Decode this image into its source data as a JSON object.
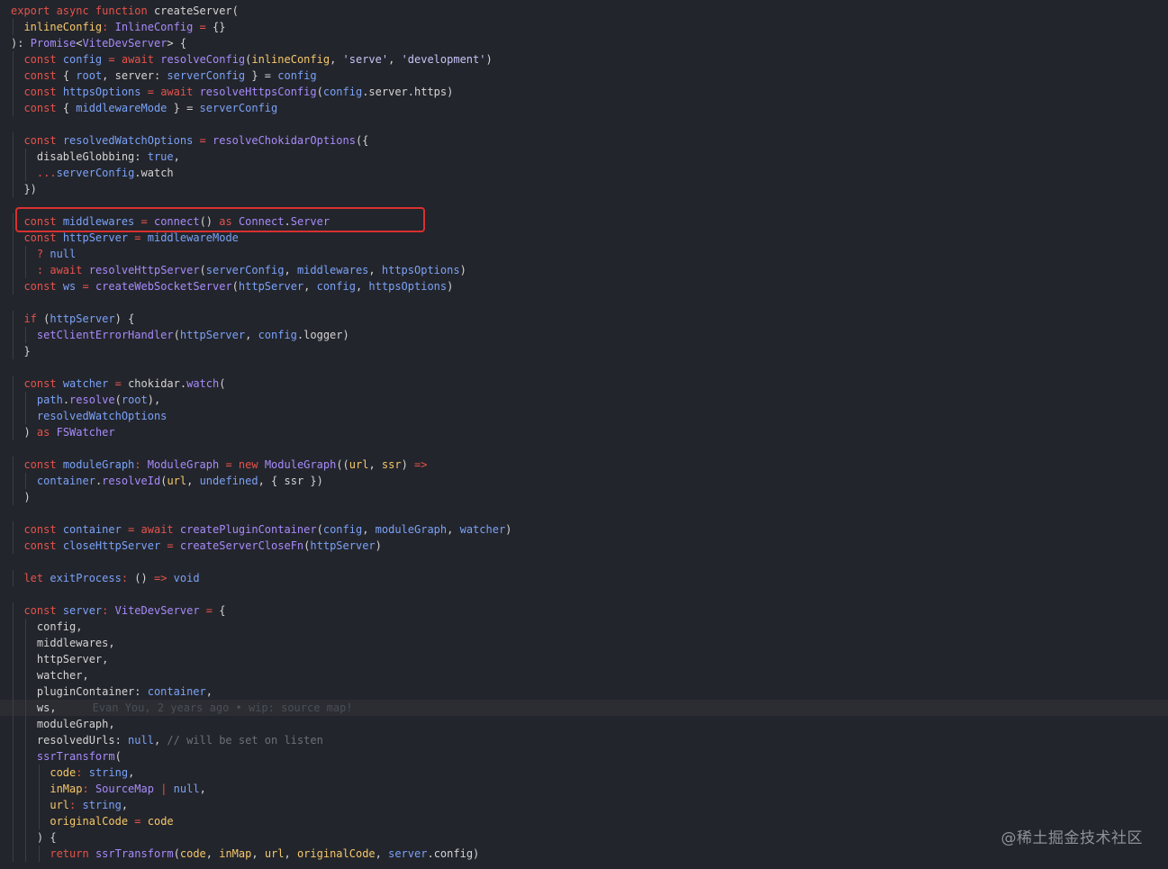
{
  "editor": {
    "current_line_index": 43,
    "indent_char_width": 7.2,
    "colors": {
      "background": "#23252c",
      "keyword": "#e5534b",
      "function": "#a78bfa",
      "identifier": "#7aa2f7",
      "type": "#a78bfa",
      "string": "#c4c4f5",
      "plain": "#d4d4d4",
      "operator": "#e5534b",
      "param": "#f5c86a",
      "comment": "#6b7079",
      "literal": "#7aa2f7",
      "highlight_box": "#d8302f"
    },
    "lines": [
      [
        {
          "t": "export async function ",
          "c": "keyword"
        },
        {
          "t": "createServer",
          "c": "plain"
        },
        {
          "t": "(",
          "c": "plain"
        }
      ],
      [
        {
          "t": "  ",
          "c": "plain"
        },
        {
          "t": "inlineConfig",
          "c": "param"
        },
        {
          "t": ": ",
          "c": "operator"
        },
        {
          "t": "InlineConfig",
          "c": "type"
        },
        {
          "t": " = ",
          "c": "operator"
        },
        {
          "t": "{}",
          "c": "plain"
        }
      ],
      [
        {
          "t": "): ",
          "c": "plain"
        },
        {
          "t": "Promise",
          "c": "type"
        },
        {
          "t": "<",
          "c": "plain"
        },
        {
          "t": "ViteDevServer",
          "c": "type"
        },
        {
          "t": "> {",
          "c": "plain"
        }
      ],
      [
        {
          "t": "  ",
          "c": "plain"
        },
        {
          "t": "const ",
          "c": "keyword"
        },
        {
          "t": "config",
          "c": "identifier"
        },
        {
          "t": " = ",
          "c": "operator"
        },
        {
          "t": "await ",
          "c": "keyword"
        },
        {
          "t": "resolveConfig",
          "c": "function"
        },
        {
          "t": "(",
          "c": "plain"
        },
        {
          "t": "inlineConfig",
          "c": "param"
        },
        {
          "t": ", ",
          "c": "plain"
        },
        {
          "t": "'serve'",
          "c": "string"
        },
        {
          "t": ", ",
          "c": "plain"
        },
        {
          "t": "'development'",
          "c": "string"
        },
        {
          "t": ")",
          "c": "plain"
        }
      ],
      [
        {
          "t": "  ",
          "c": "plain"
        },
        {
          "t": "const ",
          "c": "keyword"
        },
        {
          "t": "{ ",
          "c": "plain"
        },
        {
          "t": "root",
          "c": "identifier"
        },
        {
          "t": ", server: ",
          "c": "plain"
        },
        {
          "t": "serverConfig",
          "c": "identifier"
        },
        {
          "t": " } = ",
          "c": "plain"
        },
        {
          "t": "config",
          "c": "identifier"
        }
      ],
      [
        {
          "t": "  ",
          "c": "plain"
        },
        {
          "t": "const ",
          "c": "keyword"
        },
        {
          "t": "httpsOptions",
          "c": "identifier"
        },
        {
          "t": " = ",
          "c": "operator"
        },
        {
          "t": "await ",
          "c": "keyword"
        },
        {
          "t": "resolveHttpsConfig",
          "c": "function"
        },
        {
          "t": "(",
          "c": "plain"
        },
        {
          "t": "config",
          "c": "identifier"
        },
        {
          "t": ".server.https)",
          "c": "plain"
        }
      ],
      [
        {
          "t": "  ",
          "c": "plain"
        },
        {
          "t": "const ",
          "c": "keyword"
        },
        {
          "t": "{ ",
          "c": "plain"
        },
        {
          "t": "middlewareMode",
          "c": "identifier"
        },
        {
          "t": " } = ",
          "c": "plain"
        },
        {
          "t": "serverConfig",
          "c": "identifier"
        }
      ],
      [
        {
          "t": "",
          "c": "plain"
        }
      ],
      [
        {
          "t": "  ",
          "c": "plain"
        },
        {
          "t": "const ",
          "c": "keyword"
        },
        {
          "t": "resolvedWatchOptions",
          "c": "identifier"
        },
        {
          "t": " = ",
          "c": "operator"
        },
        {
          "t": "resolveChokidarOptions",
          "c": "function"
        },
        {
          "t": "({",
          "c": "plain"
        }
      ],
      [
        {
          "t": "    ",
          "c": "plain"
        },
        {
          "t": "disableGlobbing: ",
          "c": "plain"
        },
        {
          "t": "true",
          "c": "literal"
        },
        {
          "t": ",",
          "c": "plain"
        }
      ],
      [
        {
          "t": "    ",
          "c": "plain"
        },
        {
          "t": "...",
          "c": "operator"
        },
        {
          "t": "serverConfig",
          "c": "identifier"
        },
        {
          "t": ".watch",
          "c": "plain"
        }
      ],
      [
        {
          "t": "  })",
          "c": "plain"
        }
      ],
      [
        {
          "t": "",
          "c": "plain"
        }
      ],
      [
        {
          "t": "  ",
          "c": "plain"
        },
        {
          "t": "const ",
          "c": "keyword"
        },
        {
          "t": "middlewares",
          "c": "identifier"
        },
        {
          "t": " = ",
          "c": "operator"
        },
        {
          "t": "connect",
          "c": "function"
        },
        {
          "t": "() ",
          "c": "plain"
        },
        {
          "t": "as ",
          "c": "keyword"
        },
        {
          "t": "Connect",
          "c": "type"
        },
        {
          "t": ".",
          "c": "plain"
        },
        {
          "t": "Server",
          "c": "type"
        }
      ],
      [
        {
          "t": "  ",
          "c": "plain"
        },
        {
          "t": "const ",
          "c": "keyword"
        },
        {
          "t": "httpServer",
          "c": "identifier"
        },
        {
          "t": " = ",
          "c": "operator"
        },
        {
          "t": "middlewareMode",
          "c": "identifier"
        }
      ],
      [
        {
          "t": "    ",
          "c": "plain"
        },
        {
          "t": "? ",
          "c": "operator"
        },
        {
          "t": "null",
          "c": "literal"
        }
      ],
      [
        {
          "t": "    ",
          "c": "plain"
        },
        {
          "t": ": ",
          "c": "operator"
        },
        {
          "t": "await ",
          "c": "keyword"
        },
        {
          "t": "resolveHttpServer",
          "c": "function"
        },
        {
          "t": "(",
          "c": "plain"
        },
        {
          "t": "serverConfig",
          "c": "identifier"
        },
        {
          "t": ", ",
          "c": "plain"
        },
        {
          "t": "middlewares",
          "c": "identifier"
        },
        {
          "t": ", ",
          "c": "plain"
        },
        {
          "t": "httpsOptions",
          "c": "identifier"
        },
        {
          "t": ")",
          "c": "plain"
        }
      ],
      [
        {
          "t": "  ",
          "c": "plain"
        },
        {
          "t": "const ",
          "c": "keyword"
        },
        {
          "t": "ws",
          "c": "identifier"
        },
        {
          "t": " = ",
          "c": "operator"
        },
        {
          "t": "createWebSocketServer",
          "c": "function"
        },
        {
          "t": "(",
          "c": "plain"
        },
        {
          "t": "httpServer",
          "c": "identifier"
        },
        {
          "t": ", ",
          "c": "plain"
        },
        {
          "t": "config",
          "c": "identifier"
        },
        {
          "t": ", ",
          "c": "plain"
        },
        {
          "t": "httpsOptions",
          "c": "identifier"
        },
        {
          "t": ")",
          "c": "plain"
        }
      ],
      [
        {
          "t": "",
          "c": "plain"
        }
      ],
      [
        {
          "t": "  ",
          "c": "plain"
        },
        {
          "t": "if ",
          "c": "keyword"
        },
        {
          "t": "(",
          "c": "plain"
        },
        {
          "t": "httpServer",
          "c": "identifier"
        },
        {
          "t": ") {",
          "c": "plain"
        }
      ],
      [
        {
          "t": "    ",
          "c": "plain"
        },
        {
          "t": "setClientErrorHandler",
          "c": "function"
        },
        {
          "t": "(",
          "c": "plain"
        },
        {
          "t": "httpServer",
          "c": "identifier"
        },
        {
          "t": ", ",
          "c": "plain"
        },
        {
          "t": "config",
          "c": "identifier"
        },
        {
          "t": ".logger)",
          "c": "plain"
        }
      ],
      [
        {
          "t": "  }",
          "c": "plain"
        }
      ],
      [
        {
          "t": "",
          "c": "plain"
        }
      ],
      [
        {
          "t": "  ",
          "c": "plain"
        },
        {
          "t": "const ",
          "c": "keyword"
        },
        {
          "t": "watcher",
          "c": "identifier"
        },
        {
          "t": " = ",
          "c": "operator"
        },
        {
          "t": "chokidar",
          "c": "plain"
        },
        {
          "t": ".",
          "c": "plain"
        },
        {
          "t": "watch",
          "c": "function"
        },
        {
          "t": "(",
          "c": "plain"
        }
      ],
      [
        {
          "t": "    ",
          "c": "plain"
        },
        {
          "t": "path",
          "c": "identifier"
        },
        {
          "t": ".",
          "c": "plain"
        },
        {
          "t": "resolve",
          "c": "function"
        },
        {
          "t": "(",
          "c": "plain"
        },
        {
          "t": "root",
          "c": "identifier"
        },
        {
          "t": "),",
          "c": "plain"
        }
      ],
      [
        {
          "t": "    ",
          "c": "plain"
        },
        {
          "t": "resolvedWatchOptions",
          "c": "identifier"
        }
      ],
      [
        {
          "t": "  ) ",
          "c": "plain"
        },
        {
          "t": "as ",
          "c": "keyword"
        },
        {
          "t": "FSWatcher",
          "c": "type"
        }
      ],
      [
        {
          "t": "",
          "c": "plain"
        }
      ],
      [
        {
          "t": "  ",
          "c": "plain"
        },
        {
          "t": "const ",
          "c": "keyword"
        },
        {
          "t": "moduleGraph",
          "c": "identifier"
        },
        {
          "t": ": ",
          "c": "operator"
        },
        {
          "t": "ModuleGraph",
          "c": "type"
        },
        {
          "t": " = ",
          "c": "operator"
        },
        {
          "t": "new ",
          "c": "keyword"
        },
        {
          "t": "ModuleGraph",
          "c": "function"
        },
        {
          "t": "((",
          "c": "plain"
        },
        {
          "t": "url",
          "c": "param"
        },
        {
          "t": ", ",
          "c": "plain"
        },
        {
          "t": "ssr",
          "c": "param"
        },
        {
          "t": ") ",
          "c": "plain"
        },
        {
          "t": "=>",
          "c": "operator"
        }
      ],
      [
        {
          "t": "    ",
          "c": "plain"
        },
        {
          "t": "container",
          "c": "identifier"
        },
        {
          "t": ".",
          "c": "plain"
        },
        {
          "t": "resolveId",
          "c": "function"
        },
        {
          "t": "(",
          "c": "plain"
        },
        {
          "t": "url",
          "c": "param"
        },
        {
          "t": ", ",
          "c": "plain"
        },
        {
          "t": "undefined",
          "c": "literal"
        },
        {
          "t": ", { ssr })",
          "c": "plain"
        }
      ],
      [
        {
          "t": "  )",
          "c": "plain"
        }
      ],
      [
        {
          "t": "",
          "c": "plain"
        }
      ],
      [
        {
          "t": "  ",
          "c": "plain"
        },
        {
          "t": "const ",
          "c": "keyword"
        },
        {
          "t": "container",
          "c": "identifier"
        },
        {
          "t": " = ",
          "c": "operator"
        },
        {
          "t": "await ",
          "c": "keyword"
        },
        {
          "t": "createPluginContainer",
          "c": "function"
        },
        {
          "t": "(",
          "c": "plain"
        },
        {
          "t": "config",
          "c": "identifier"
        },
        {
          "t": ", ",
          "c": "plain"
        },
        {
          "t": "moduleGraph",
          "c": "identifier"
        },
        {
          "t": ", ",
          "c": "plain"
        },
        {
          "t": "watcher",
          "c": "identifier"
        },
        {
          "t": ")",
          "c": "plain"
        }
      ],
      [
        {
          "t": "  ",
          "c": "plain"
        },
        {
          "t": "const ",
          "c": "keyword"
        },
        {
          "t": "closeHttpServer",
          "c": "identifier"
        },
        {
          "t": " = ",
          "c": "operator"
        },
        {
          "t": "createServerCloseFn",
          "c": "function"
        },
        {
          "t": "(",
          "c": "plain"
        },
        {
          "t": "httpServer",
          "c": "identifier"
        },
        {
          "t": ")",
          "c": "plain"
        }
      ],
      [
        {
          "t": "",
          "c": "plain"
        }
      ],
      [
        {
          "t": "  ",
          "c": "plain"
        },
        {
          "t": "let ",
          "c": "keyword"
        },
        {
          "t": "exitProcess",
          "c": "identifier"
        },
        {
          "t": ": ",
          "c": "operator"
        },
        {
          "t": "() ",
          "c": "plain"
        },
        {
          "t": "=> ",
          "c": "operator"
        },
        {
          "t": "void",
          "c": "literal"
        }
      ],
      [
        {
          "t": "",
          "c": "plain"
        }
      ],
      [
        {
          "t": "  ",
          "c": "plain"
        },
        {
          "t": "const ",
          "c": "keyword"
        },
        {
          "t": "server",
          "c": "identifier"
        },
        {
          "t": ": ",
          "c": "operator"
        },
        {
          "t": "ViteDevServer",
          "c": "type"
        },
        {
          "t": " = ",
          "c": "operator"
        },
        {
          "t": "{",
          "c": "plain"
        }
      ],
      [
        {
          "t": "    config,",
          "c": "plain"
        }
      ],
      [
        {
          "t": "    middlewares,",
          "c": "plain"
        }
      ],
      [
        {
          "t": "    httpServer,",
          "c": "plain"
        }
      ],
      [
        {
          "t": "    watcher,",
          "c": "plain"
        }
      ],
      [
        {
          "t": "    pluginContainer: ",
          "c": "plain"
        },
        {
          "t": "container",
          "c": "identifier"
        },
        {
          "t": ",",
          "c": "plain"
        }
      ],
      [
        {
          "t": "    ws,",
          "c": "plain"
        },
        {
          "t": "Evan You, 2 years ago • wip: source map!",
          "c": "blame"
        }
      ],
      [
        {
          "t": "    moduleGraph,",
          "c": "plain"
        }
      ],
      [
        {
          "t": "    resolvedUrls: ",
          "c": "plain"
        },
        {
          "t": "null",
          "c": "literal"
        },
        {
          "t": ", ",
          "c": "plain"
        },
        {
          "t": "// will be set on listen",
          "c": "comment"
        }
      ],
      [
        {
          "t": "    ",
          "c": "plain"
        },
        {
          "t": "ssrTransform",
          "c": "function"
        },
        {
          "t": "(",
          "c": "plain"
        }
      ],
      [
        {
          "t": "      ",
          "c": "plain"
        },
        {
          "t": "code",
          "c": "param"
        },
        {
          "t": ": ",
          "c": "operator"
        },
        {
          "t": "string",
          "c": "literal"
        },
        {
          "t": ",",
          "c": "plain"
        }
      ],
      [
        {
          "t": "      ",
          "c": "plain"
        },
        {
          "t": "inMap",
          "c": "param"
        },
        {
          "t": ": ",
          "c": "operator"
        },
        {
          "t": "SourceMap",
          "c": "type"
        },
        {
          "t": " | ",
          "c": "operator"
        },
        {
          "t": "null",
          "c": "literal"
        },
        {
          "t": ",",
          "c": "plain"
        }
      ],
      [
        {
          "t": "      ",
          "c": "plain"
        },
        {
          "t": "url",
          "c": "param"
        },
        {
          "t": ": ",
          "c": "operator"
        },
        {
          "t": "string",
          "c": "literal"
        },
        {
          "t": ",",
          "c": "plain"
        }
      ],
      [
        {
          "t": "      ",
          "c": "plain"
        },
        {
          "t": "originalCode",
          "c": "param"
        },
        {
          "t": " = ",
          "c": "operator"
        },
        {
          "t": "code",
          "c": "param"
        }
      ],
      [
        {
          "t": "    ) {",
          "c": "plain"
        }
      ],
      [
        {
          "t": "      ",
          "c": "plain"
        },
        {
          "t": "return ",
          "c": "keyword"
        },
        {
          "t": "ssrTransform",
          "c": "function"
        },
        {
          "t": "(",
          "c": "plain"
        },
        {
          "t": "code",
          "c": "param"
        },
        {
          "t": ", ",
          "c": "plain"
        },
        {
          "t": "inMap",
          "c": "param"
        },
        {
          "t": ", ",
          "c": "plain"
        },
        {
          "t": "url",
          "c": "param"
        },
        {
          "t": ", ",
          "c": "plain"
        },
        {
          "t": "originalCode",
          "c": "param"
        },
        {
          "t": ", ",
          "c": "plain"
        },
        {
          "t": "server",
          "c": "identifier"
        },
        {
          "t": ".config)",
          "c": "plain"
        }
      ]
    ],
    "highlighted_line_index": 13
  },
  "watermark": {
    "text": "@稀土掘金技术社区"
  }
}
